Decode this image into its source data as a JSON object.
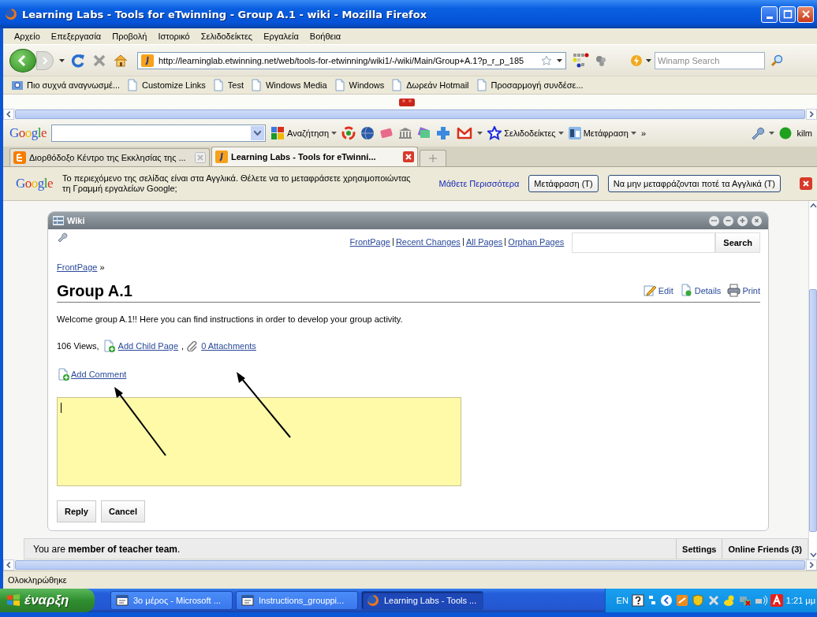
{
  "window": {
    "title": "Learning Labs - Tools for eTwinning - Group A.1 - wiki - Mozilla Firefox"
  },
  "menu": [
    "Αρχείο",
    "Επεξεργασία",
    "Προβολή",
    "Ιστορικό",
    "Σελιδοδείκτες",
    "Εργαλεία",
    "Βοήθεια"
  ],
  "navigation": {
    "url": "http://learninglab.etwinning.net/web/tools-for-etwinning/wiki1/-/wiki/Main/Group+A.1?p_r_p_185",
    "search_placeholder": "Winamp Search"
  },
  "bookmarks": [
    {
      "label": "Πιο συχνά αναγνωσμέ...",
      "kind": "smart"
    },
    {
      "label": "Customize Links",
      "kind": "page"
    },
    {
      "label": "Test",
      "kind": "page"
    },
    {
      "label": "Windows Media",
      "kind": "page"
    },
    {
      "label": "Windows",
      "kind": "page"
    },
    {
      "label": "Δωρεάν Hotmail",
      "kind": "page"
    },
    {
      "label": "Προσαρμογή συνδέσε...",
      "kind": "page"
    }
  ],
  "google_toolbar": {
    "logo": "Google",
    "search_button": "Αναζήτηση",
    "bookmarks_menu": "Σελιδοδείκτες",
    "translate": "Μετάφραση",
    "more": "»",
    "user": "kilm"
  },
  "tabs": [
    {
      "label": "Διορθόδοξο Κέντρο της Εκκλησίας της ...",
      "kind": "blog",
      "selected": false
    },
    {
      "label": "Learning Labs - Tools for eTwinni...",
      "kind": "site",
      "selected": true
    }
  ],
  "translate_bar": {
    "logo": "Google",
    "message": "Το περιεχόμενο της σελίδας είναι στα Αγγλικά. Θέλετε να το μεταφράσετε χρησιμοποιώντας τη Γραμμή εργαλείων Google;",
    "learn_more": "Μάθετε Περισσότερα",
    "buttons": [
      "Μετάφραση (T)",
      "Να μην μεταφράζονται ποτέ τα Αγγλικά (T)"
    ]
  },
  "wiki": {
    "title": "Wiki",
    "nav_links": [
      "FrontPage",
      "Recent Changes",
      "All Pages",
      "Orphan Pages"
    ],
    "search_button": "Search",
    "breadcrumb": {
      "link": "FrontPage",
      "separator": "»"
    },
    "page_title": "Group A.1",
    "actions": [
      {
        "label": "Edit",
        "kind": "edit"
      },
      {
        "label": "Details",
        "kind": "details"
      },
      {
        "label": "Print",
        "kind": "print"
      }
    ],
    "content": "Welcome group A.1!! Here you can find instructions in order to develop your group activity.",
    "views": "106 Views,",
    "add_child_page": "Add Child Page",
    "separator": ",",
    "attachments": "0 Attachments",
    "add_comment": "Add Comment",
    "buttons": [
      "Reply",
      "Cancel"
    ]
  },
  "member_bar": {
    "message": "You are **member of teacher team**.",
    "tabs": [
      "Settings",
      "Online Friends (3)"
    ]
  },
  "status": "Ολοκληρώθηκε",
  "taskbar": {
    "start": "έναρξη",
    "items": [
      {
        "label": "3ο μέρος - Microsoft ...",
        "kind": "word",
        "selected": false
      },
      {
        "label": "Instructions_grouppi...",
        "kind": "word",
        "selected": false
      },
      {
        "label": "Learning Labs - Tools ...",
        "kind": "firefox",
        "selected": true
      }
    ],
    "language": "EN",
    "clock": "1:21 μμ"
  }
}
